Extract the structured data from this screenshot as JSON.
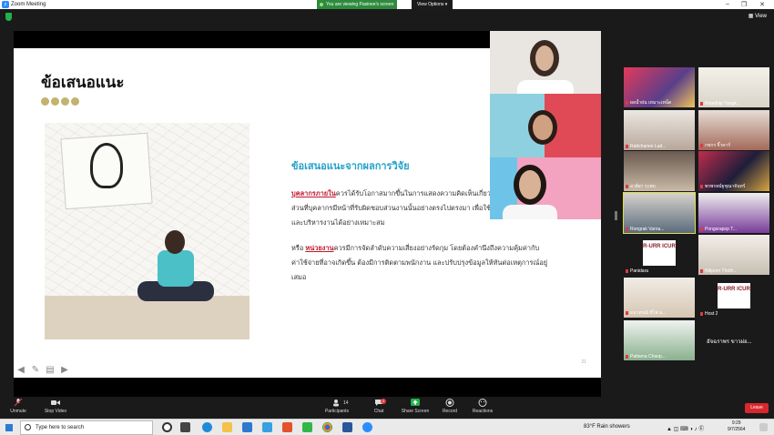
{
  "window": {
    "title": "Zoom Meeting",
    "minimize": "–",
    "maximize": "❐",
    "close": "✕"
  },
  "share_banner": {
    "text": "You are viewing Pasinee's screen",
    "view_options": "View Options ▾"
  },
  "topbar": {
    "view_label": "▦ View"
  },
  "slide": {
    "title": "ข้อเสนอแนะ",
    "section_heading": "ข้อเสนอแนะจากผลการวิจัย",
    "p1_highlight": "บุคลากรภายใน",
    "p1_rest": "ควรได้รับโอกาสมากขึ้นในการแสดงความคิดเห็นเกี่ยวกั",
    "p1_line2": "ส่วนที่บุคลากรมีหน้าที่รับผิดชอบส่วนงานนั้นอย่างตรงไปตรงมา เพื่อใช้",
    "p1_line3": "และบริหารงานได้อย่างเหมาะสม",
    "p2_prefix": "หรือ ",
    "p2_highlight": "หน่วยงาน",
    "p2_rest": "ควรมีการจัดลำดับความเสี่ยงอย่างรัดกุม โดยต้องคำนึงถึงความคุ้มค่ากับ",
    "p2_line2": "ค่าใช้จ่ายที่อาจเกิดขึ้น ต้องมีการติดตามพนักงาน และปรับปรุงข้อมูลให้ทันต่อเหตุการณ์อยู่",
    "p2_line3": "เสมอ",
    "page_number": "21"
  },
  "gallery": [
    {
      "name": "ผลน้ำฝน เหมาะเหน็ด"
    },
    {
      "name": "Khanthip Yangk..."
    },
    {
      "name": "Rattchanee Lad..."
    },
    {
      "name": "กชกร จิ๊วคาร์"
    },
    {
      "name": "อาย์ยา ระทบ"
    },
    {
      "name": "พรพรหม์ฐชุณาจันทร์"
    },
    {
      "name": "Rongrak Varna..."
    },
    {
      "name": "Pongsrapop T..."
    },
    {
      "name": "Panidara"
    },
    {
      "name": "Nitiporn Thoth..."
    },
    {
      "name": "ธนาทรณ์ ทีไฟ ม..."
    },
    {
      "name": "Host 2"
    },
    {
      "name": "Pattama Chaop..."
    },
    {
      "name": "อัจฉราพร ขาวผ่อ..."
    }
  ],
  "brand_badge": "R-URR ICUR",
  "toolbar": {
    "unmute": "Unmute",
    "stop_video": "Stop Video",
    "participants": "Participants",
    "participants_count": "14",
    "chat": "Chat",
    "chat_badge": "2",
    "share_screen": "Share Screen",
    "record": "Record",
    "reactions": "Reactions",
    "leave": "Leave"
  },
  "taskbar": {
    "search_placeholder": "Type here to search",
    "weather": "83°F  Rain showers",
    "time": "9:29",
    "date": "9/7/2564"
  },
  "colors": {
    "accent": "#2d8cff",
    "share_green": "#2e8b3d",
    "leave_red": "#d9272e",
    "heading_blue": "#23a2c8",
    "highlight_red": "#c0192e"
  }
}
